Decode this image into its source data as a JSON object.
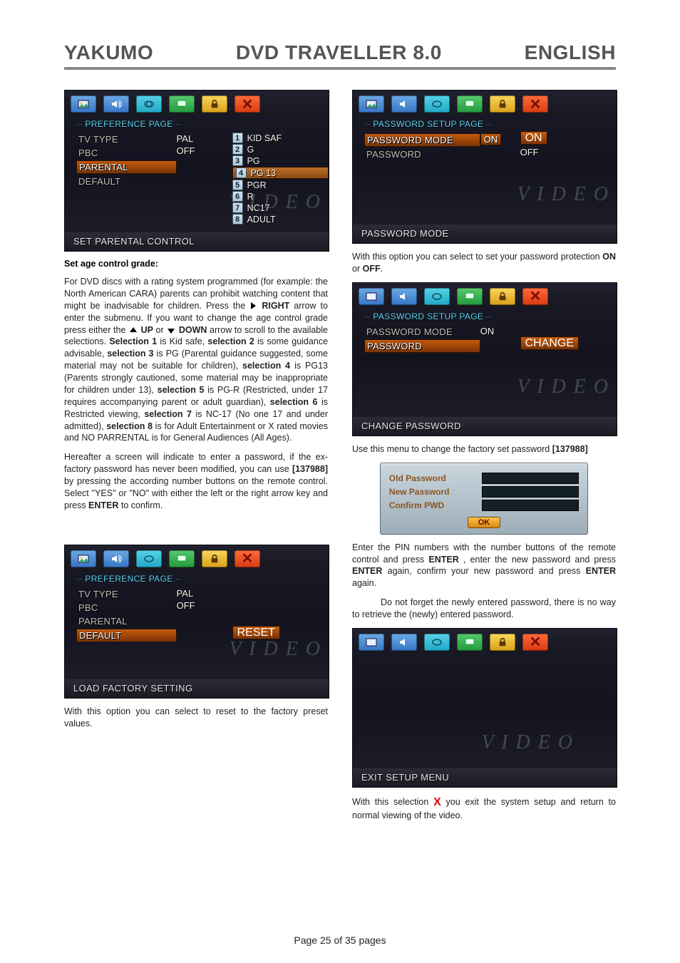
{
  "header": {
    "brand": "YAKUMO",
    "product": "DVD TRAVELLER 8.0",
    "language": "ENGLISH"
  },
  "footer": {
    "line": "Page 25 of 35 pages"
  },
  "tabs_semantic": [
    "picture",
    "audio",
    "subtitle",
    "display",
    "lock",
    "close"
  ],
  "osd_preference_parental": {
    "crumb": "PREFERENCE PAGE",
    "left": [
      "TV TYPE",
      "PBC",
      "PARENTAL",
      "DEFAULT"
    ],
    "mid": [
      "PAL",
      "OFF"
    ],
    "options": [
      "KID SAF",
      "G",
      "PG",
      "PG 13",
      "PGR",
      "R",
      "NC17",
      "ADULT"
    ],
    "highlighted": 4,
    "footer": "SET PARENTAL CONTROL",
    "brand": "V I D E O"
  },
  "osd_preference_default": {
    "crumb": "PREFERENCE PAGE",
    "left": [
      "TV TYPE",
      "PBC",
      "PARENTAL",
      "DEFAULT"
    ],
    "mid": [
      "PAL",
      "OFF"
    ],
    "right_action": "RESET",
    "footer": "LOAD FACTORY SETTING",
    "brand": "V I D E O"
  },
  "osd_password_mode": {
    "crumb": "PASSWORD SETUP PAGE",
    "left": [
      "PASSWORD MODE",
      "PASSWORD"
    ],
    "mid_selected": "ON",
    "right": [
      "ON",
      "OFF"
    ],
    "footer": "PASSWORD MODE",
    "brand": "V I D E O"
  },
  "osd_password_change": {
    "crumb": "PASSWORD SETUP PAGE",
    "left": [
      "PASSWORD MODE",
      "PASSWORD"
    ],
    "mid_value": "ON",
    "right_action": "CHANGE",
    "footer": "CHANGE PASSWORD",
    "brand": "V I D E O"
  },
  "pwdlg": {
    "rows": [
      "Old Password",
      "New Password",
      "Confirm PWD"
    ],
    "ok": "OK"
  },
  "osd_exit": {
    "footer": "EXIT SETUP MENU",
    "brand": "V I D E O"
  },
  "text": {
    "sac_title": "Set age control grade:",
    "sac_p1a": "For DVD discs with a rating system programmed (for example: the North American CARA) parents can prohibit watching content that might be inadvisable for children. Press the ",
    "sac_right": "RIGHT",
    "sac_p1b": " arrow to enter the submenu. If you want to change the age control grade press either the ",
    "sac_up": "UP",
    "sac_or": " or ",
    "sac_down": "DOWN",
    "sac_p1c": " arrow to scroll to the available selections. ",
    "sac_sel1a": "Selection 1",
    "sac_sel1b": " is Kid safe, ",
    "sac_sel2a": "selection 2",
    "sac_sel2b": " is some guidance advisable, ",
    "sac_sel3a": "selection 3",
    "sac_sel3b": " is PG (Parental guidance suggested, some material may not be suitable for children), ",
    "sac_sel4a": "selection 4",
    "sac_sel4b": " is PG13 (Parents strongly cautioned, some material may be inappropriate for children under 13), ",
    "sac_sel5a": "selection 5",
    "sac_sel5b": " is PG-R (Restricted, under 17 requires accompanying parent or adult guardian), ",
    "sac_sel6a": "selection 6",
    "sac_sel6b": " is Restricted viewing, ",
    "sac_sel7a": "selection 7",
    "sac_sel7b": " is NC-17 (No one 17 and under admitted), ",
    "sac_sel8a": "selection 8",
    "sac_sel8b": " is for Adult Entertainment or X rated movies and NO PARRENTAL is for General Audiences (All Ages).",
    "sac_p2a": "Hereafter a screen will indicate to enter a password, if the ex-factory password has never been modified, you can use ",
    "sac_p2code": "[137988]",
    "sac_p2b": " by pressing the according number buttons on the remote control. Select \"YES\" or \"NO\" with either the left or the right arrow key and press ",
    "enter": "ENTER",
    "sac_p2c": " to confirm.",
    "resetline": "With this option you can select to reset to the factory preset values.",
    "pwmode_line_a": "With this option you can select to set your password protection ",
    "on": "ON",
    "off": "OFF",
    "or_word": " or ",
    "period": ".",
    "changepw": "Use this menu to change the factory set password ",
    "changepw_code": "[137988]",
    "enterpins_a": "Enter the PIN numbers with the number buttons of the remote control and press ",
    "enterpins_b": ", enter the new password and press ",
    "enterpins_c": " again, confirm your new password and press ",
    "enterpins_d": " again.",
    "dontforget": "Do not forget the newly entered password, there is no way to retrieve the (newly) entered password.",
    "exit_a": "With this selection ",
    "exit_x": "X",
    "exit_b": " you exit the system setup and return to normal viewing of the video."
  }
}
